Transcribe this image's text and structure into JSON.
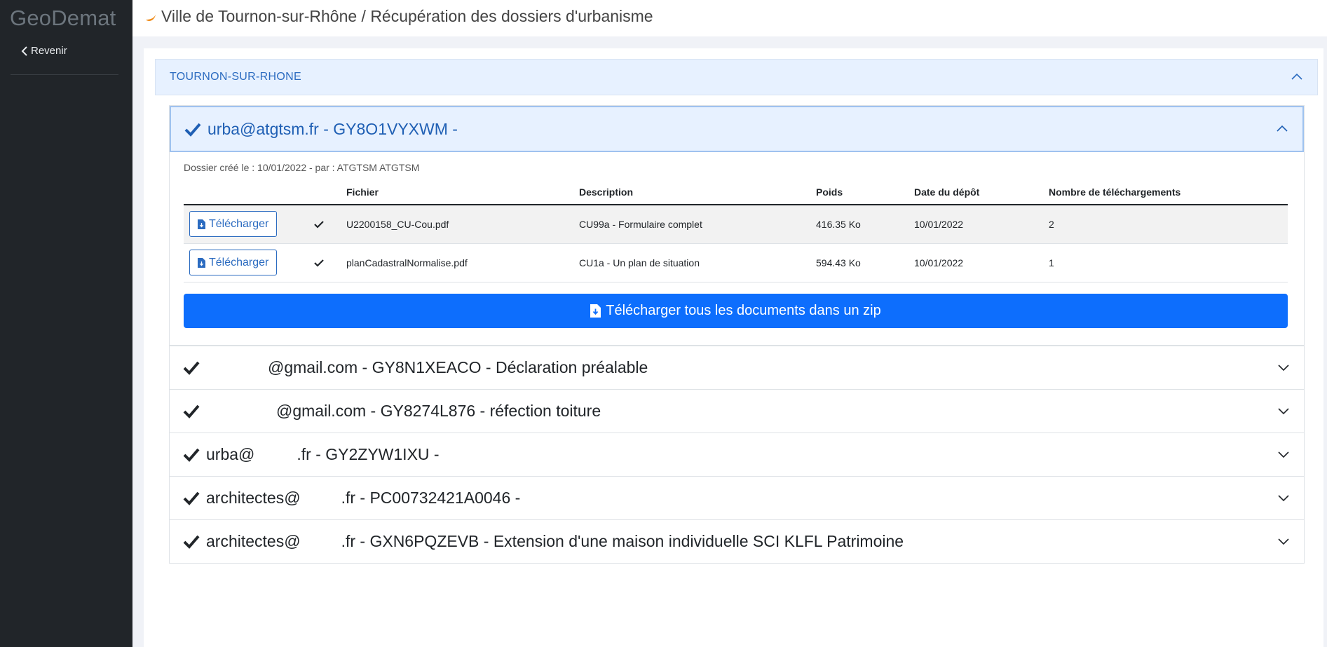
{
  "app": {
    "brand": "GeoDemat"
  },
  "sidebar": {
    "back_label": "Revenir"
  },
  "header": {
    "title": "Ville de Tournon-sur-Rhône / Récupération des dossiers d'urbanisme"
  },
  "town": {
    "label": "TOURNON-SUR-RHONE"
  },
  "open_dossier": {
    "title": "urba@atgtsm.fr - GY8O1VYXWM -",
    "meta": "Dossier créé le : 10/01/2022 - par : ATGTSM ATGTSM",
    "columns": [
      "",
      "",
      "Fichier",
      "Description",
      "Poids",
      "Date du dépôt",
      "Nombre de téléchargements"
    ],
    "download_label": "Télécharger",
    "files": [
      {
        "name": "U2200158_CU-Cou.pdf",
        "description": "CU99a - Formulaire complet",
        "size": "416.35 Ko",
        "date": "10/01/2022",
        "downloads": "2"
      },
      {
        "name": "planCadastralNormalise.pdf",
        "description": "CU1a - Un plan de situation",
        "size": "594.43 Ko",
        "date": "10/01/2022",
        "downloads": "1"
      }
    ],
    "zip_label": "Télécharger tous les documents dans un zip"
  },
  "dossiers": [
    {
      "title_pre": "",
      "title_post": "@gmail.com - GY8N1XEACO - Déclaration préalable"
    },
    {
      "title_pre": "",
      "title_post": "@gmail.com - GY8274L876 - réfection toiture"
    },
    {
      "title_pre": "urba@",
      "title_post": ".fr - GY2ZYW1IXU -"
    },
    {
      "title_pre": "architectes@",
      "title_post": ".fr - PC00732421A0046 -"
    },
    {
      "title_pre": "architectes@",
      "title_post": ".fr - GXN6PQZEVB - Extension d'une maison individuelle SCI KLFL Patrimoine"
    }
  ],
  "colors": {
    "primary": "#0d6efd",
    "accent_text": "#2b6bc0",
    "sidebar_bg": "#212529",
    "open_header_bg": "#e7f1ff"
  }
}
